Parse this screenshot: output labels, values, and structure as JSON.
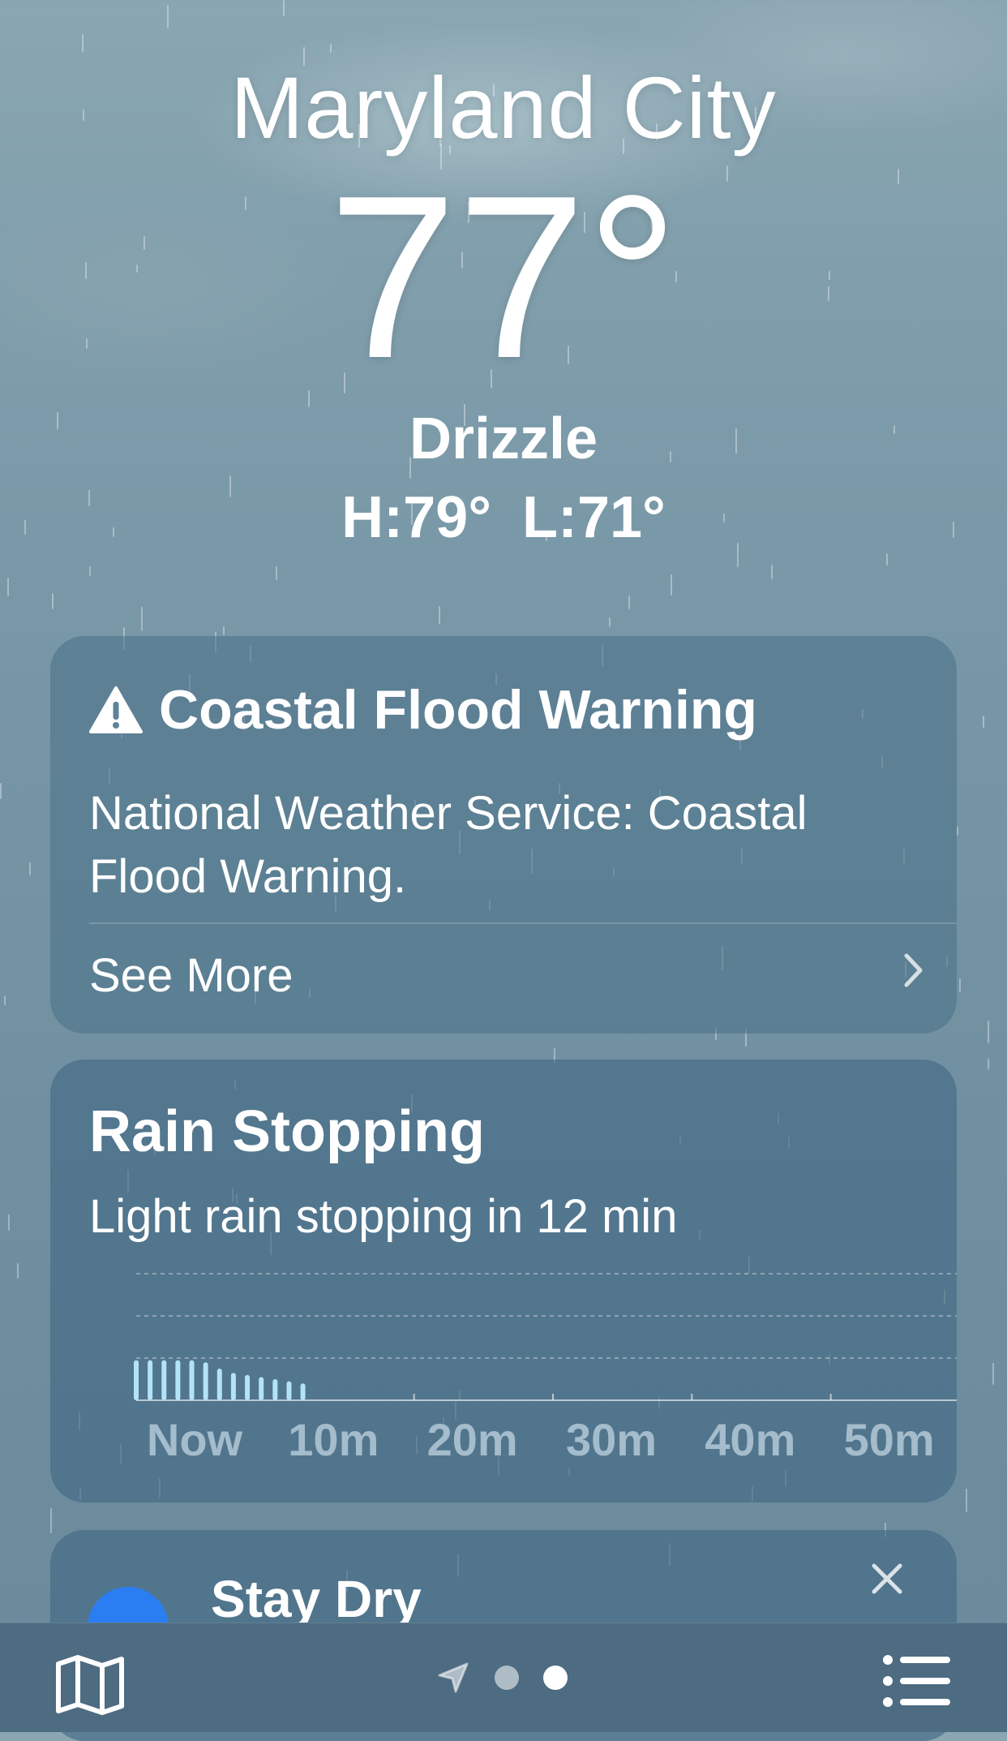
{
  "location": {
    "city": "Maryland City",
    "temperature": "77",
    "degree_symbol": "°",
    "condition": "Drizzle",
    "high": "H:79°",
    "low": "L:71°"
  },
  "alert_card": {
    "title": "Coastal Flood Warning",
    "body": "National Weather Service: Coastal Flood Warning.",
    "link_label": "See More",
    "icon": "warning-triangle-icon"
  },
  "rain_card": {
    "title": "Rain Stopping",
    "subtitle": "Light rain stopping in 12 min"
  },
  "chart_data": {
    "type": "bar",
    "title": "",
    "xlabel": "",
    "ylabel": "",
    "categories": [
      "Now",
      "10m",
      "20m",
      "30m",
      "40m",
      "50m"
    ],
    "x_minutes": [
      0,
      1,
      2,
      3,
      4,
      5,
      6,
      7,
      8,
      9,
      10,
      11,
      12
    ],
    "values": [
      0.95,
      0.95,
      0.95,
      0.95,
      0.95,
      0.9,
      0.75,
      0.65,
      0.6,
      0.55,
      0.5,
      0.45,
      0.4
    ],
    "xlim": [
      0,
      60
    ],
    "ylim": [
      0,
      3
    ],
    "grid": true,
    "bar_color": "#b3e3f7"
  },
  "dry_card": {
    "title": "Stay Dry",
    "close_icon": "close-icon"
  },
  "tab_bar": {
    "map_icon": "map-icon",
    "location_icon": "location-arrow-icon",
    "list_icon": "list-icon",
    "page_count": 2,
    "active_page": 2
  },
  "colors": {
    "accent_blue": "#2b7ef2",
    "tab_bar": "#4d6b81"
  }
}
